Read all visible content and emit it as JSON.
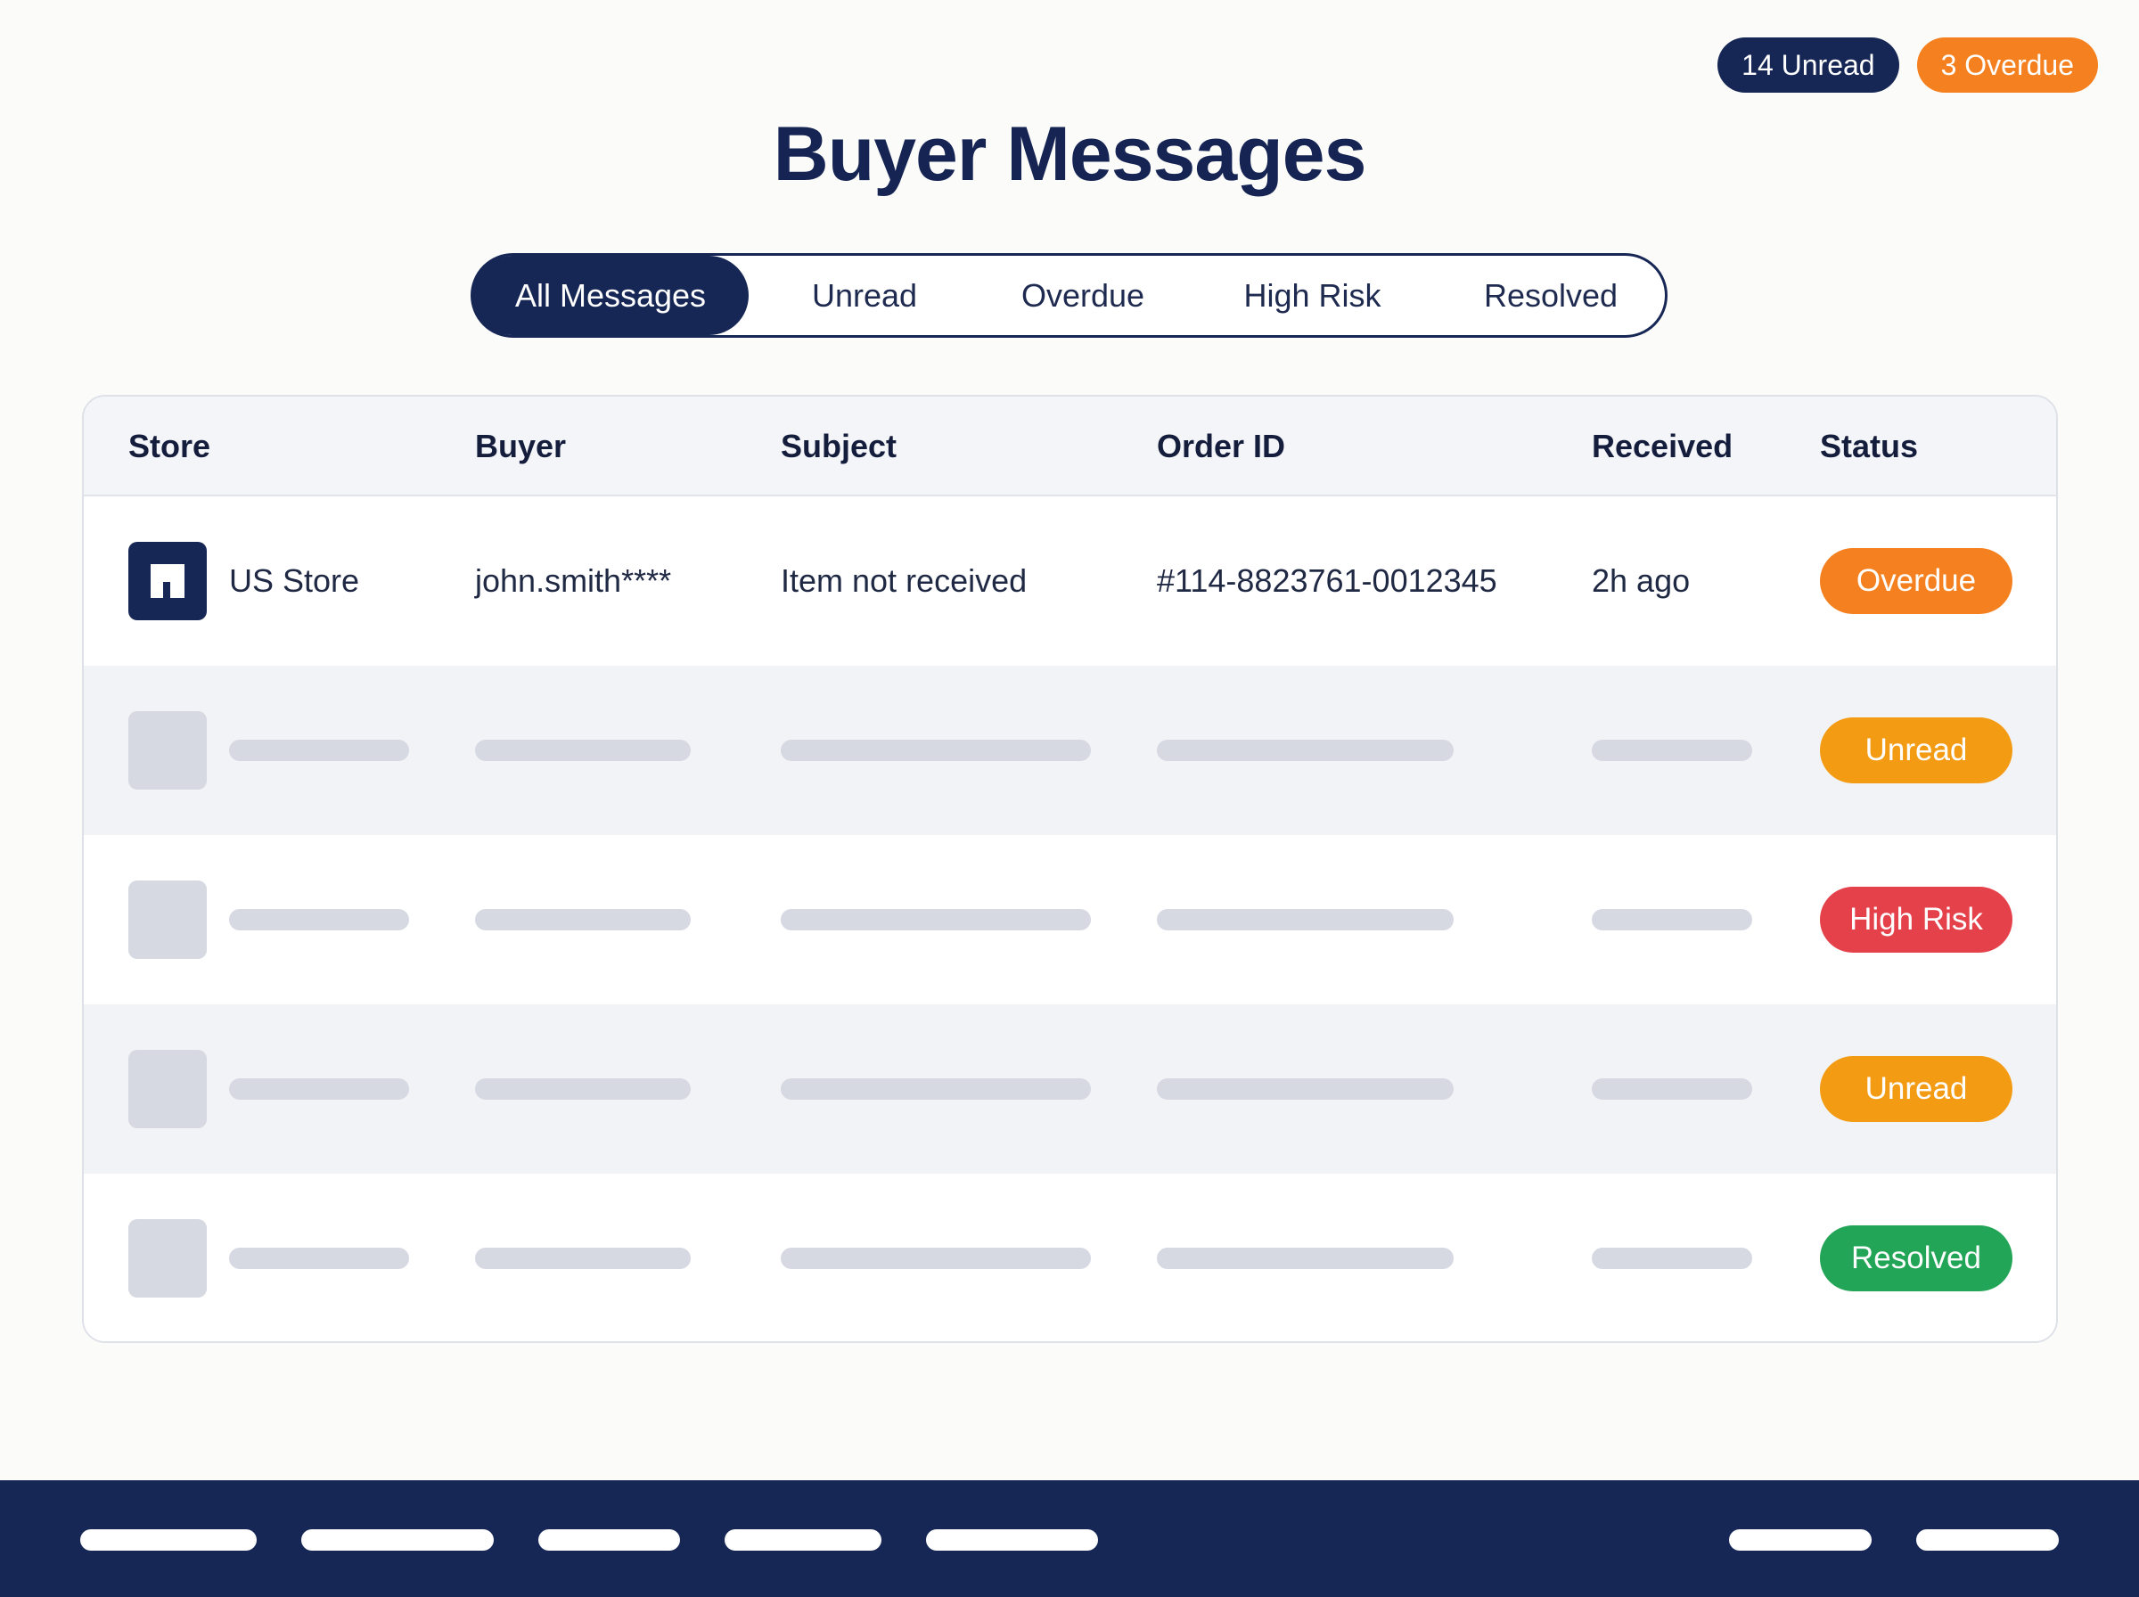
{
  "counters": {
    "unread": "14 Unread",
    "overdue": "3 Overdue"
  },
  "title": "Buyer Messages",
  "tabs": [
    {
      "label": "All Messages",
      "active": true
    },
    {
      "label": "Unread",
      "active": false
    },
    {
      "label": "Overdue",
      "active": false
    },
    {
      "label": "High Risk",
      "active": false
    },
    {
      "label": "Resolved",
      "active": false
    }
  ],
  "table": {
    "columns": [
      "Store",
      "Buyer",
      "Subject",
      "Order ID",
      "Received",
      "Status"
    ],
    "rows": [
      {
        "store": "US Store",
        "buyer": "john.smith****",
        "subject": "Item not received",
        "order_id": "#114-8823761-0012345",
        "received": "2h ago",
        "status": "Overdue"
      },
      {
        "status": "Unread"
      },
      {
        "status": "High Risk"
      },
      {
        "status": "Unread"
      },
      {
        "status": "Resolved"
      }
    ]
  },
  "colors": {
    "navy": "#172755",
    "overdue": "#f5801f",
    "unread": "#f49b14",
    "high_risk": "#e5414b",
    "resolved": "#22a556",
    "skeleton": "#d6d9e2"
  },
  "icons": {
    "store": "storefront-icon"
  }
}
